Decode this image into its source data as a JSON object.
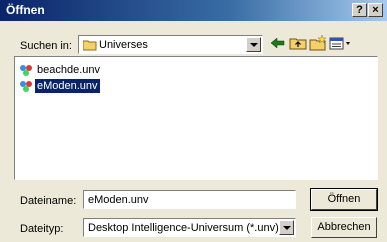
{
  "window": {
    "title": "Öffnen",
    "help_label": "?",
    "close_label": "×"
  },
  "lookin": {
    "label": "Suchen in:",
    "value": "Universes"
  },
  "files": [
    {
      "name": "beachde.unv",
      "selected": false
    },
    {
      "name": "eModen.unv",
      "selected": true
    }
  ],
  "filename": {
    "label": "Dateiname:",
    "value": "eModen.unv"
  },
  "filetype": {
    "label": "Dateityp:",
    "value": "Desktop Intelligence-Universum (*.unv)"
  },
  "buttons": {
    "open": "Öffnen",
    "cancel": "Abbrechen"
  },
  "icons": {
    "back": "back-arrow-icon",
    "up": "up-folder-icon",
    "newfolder": "new-folder-icon",
    "views": "view-menu-icon"
  },
  "colors": {
    "selection": "#0a246a",
    "dialog_bg": "#ece9d8"
  }
}
